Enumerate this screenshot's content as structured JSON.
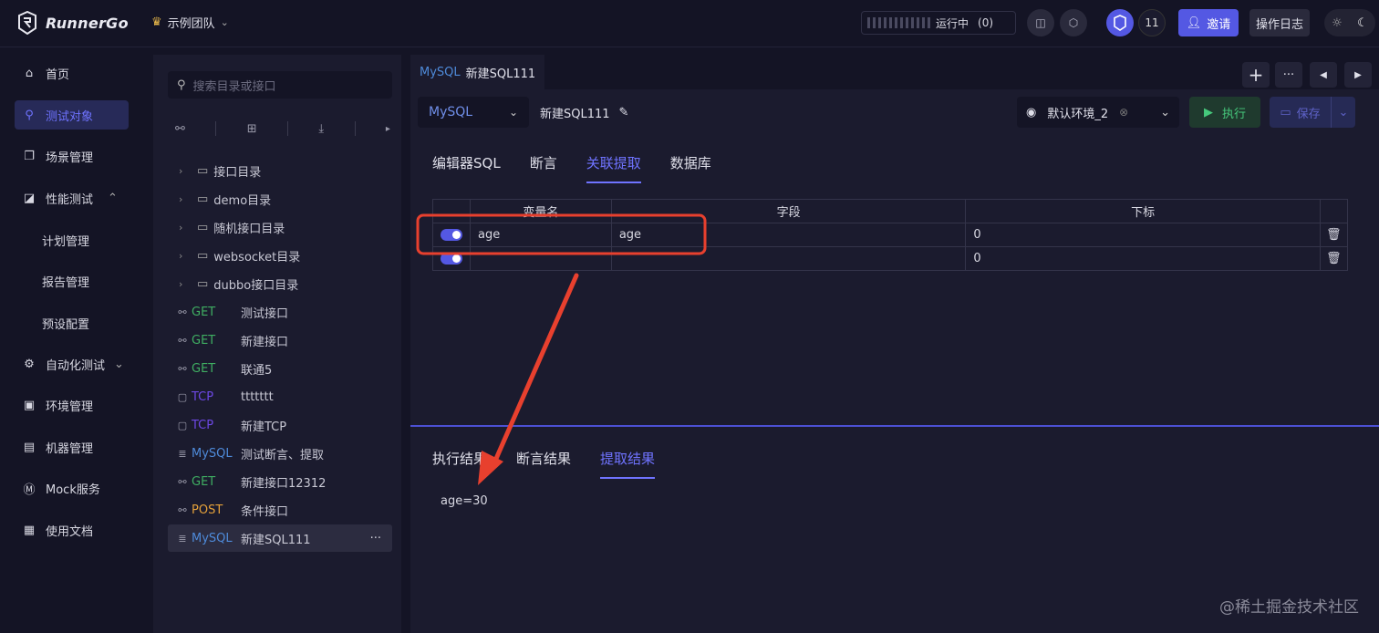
{
  "header": {
    "logo_text": "RunnerGo",
    "team_name": "示例团队",
    "running_label": "运行中",
    "running_count": "(0)",
    "user_count": "11",
    "invite_label": "邀请",
    "oplog_label": "操作日志"
  },
  "sidebar": {
    "items": [
      {
        "label": "首页",
        "icon": "home-icon"
      },
      {
        "label": "测试对象",
        "icon": "test-object-icon",
        "active": true
      },
      {
        "label": "场景管理",
        "icon": "scene-icon"
      },
      {
        "label": "性能测试",
        "icon": "performance-icon"
      },
      {
        "label": "计划管理"
      },
      {
        "label": "报告管理"
      },
      {
        "label": "预设配置"
      },
      {
        "label": "自动化测试",
        "icon": "automation-icon"
      },
      {
        "label": "环境管理",
        "icon": "environment-icon"
      },
      {
        "label": "机器管理",
        "icon": "machine-icon"
      },
      {
        "label": "Mock服务",
        "icon": "mock-icon"
      },
      {
        "label": "使用文档",
        "icon": "docs-icon"
      }
    ]
  },
  "tree": {
    "search_placeholder": "搜索目录或接口",
    "folders": [
      "接口目录",
      "demo目录",
      "随机接口目录",
      "websocket目录",
      "dubbo接口目录"
    ],
    "apis": [
      {
        "method": "GET",
        "name": "测试接口"
      },
      {
        "method": "GET",
        "name": "新建接口"
      },
      {
        "method": "GET",
        "name": "联通5"
      },
      {
        "method": "TCP",
        "name": "ttttttt"
      },
      {
        "method": "TCP",
        "name": "新建TCP"
      },
      {
        "method": "MySQL",
        "name": "测试断言、提取"
      },
      {
        "method": "GET",
        "name": "新建接口12312"
      },
      {
        "method": "POST",
        "name": "条件接口"
      },
      {
        "method": "MySQL",
        "name": "新建SQL111"
      }
    ],
    "more": "···"
  },
  "main": {
    "tab": {
      "db": "MySQL",
      "name": "新建SQL111"
    },
    "db_select": "MySQL",
    "request_name": "新建SQL111",
    "env": "默认环境_2",
    "exec_label": "执行",
    "save_label": "保存",
    "subtabs": [
      "编辑器SQL",
      "断言",
      "关联提取",
      "数据库"
    ],
    "table": {
      "headers": [
        "变量名",
        "字段",
        "下标"
      ],
      "rows": [
        {
          "var": "age",
          "field": "age",
          "index": "0"
        },
        {
          "var": "",
          "field": "",
          "index": "0"
        }
      ]
    },
    "result_tabs": [
      "执行结果",
      "断言结果",
      "提取结果"
    ],
    "result_value": "age=30"
  },
  "watermark": "@稀土掘金技术社区",
  "colors": {
    "accent": "#6f73ff",
    "annotation": "#e8402e"
  }
}
